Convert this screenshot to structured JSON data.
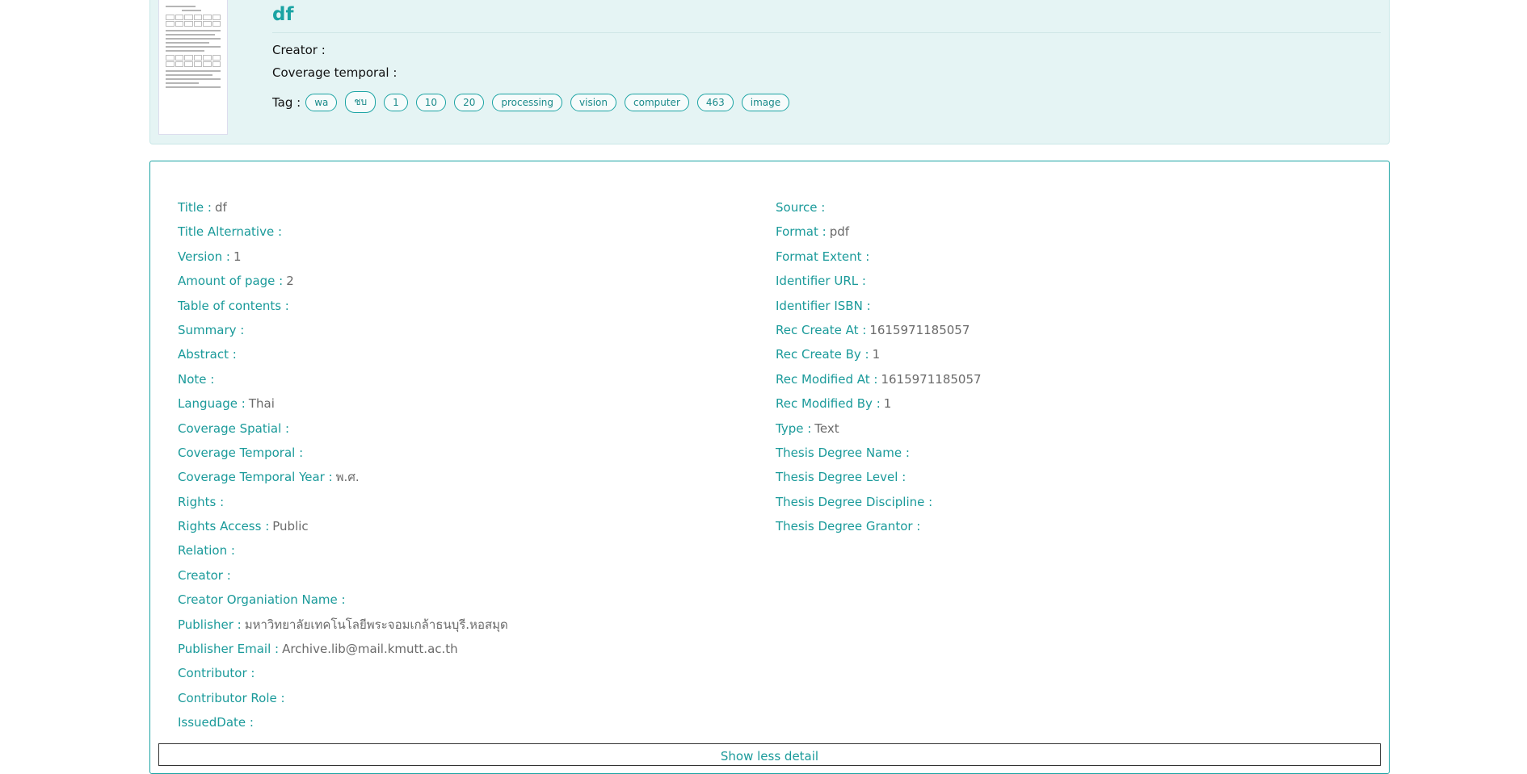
{
  "header": {
    "title": "df",
    "creator_label": "Creator :",
    "coverage_label": "Coverage temporal :",
    "tag_label": "Tag :",
    "tags": [
      "wa",
      "ชบ",
      "1",
      "10",
      "20",
      "processing",
      "vision",
      "computer",
      "463",
      "image"
    ]
  },
  "details": {
    "left": [
      {
        "label": "Title :",
        "value": "df"
      },
      {
        "label": "Title Alternative :",
        "value": ""
      },
      {
        "label": "Version :",
        "value": "1"
      },
      {
        "label": "Amount of page :",
        "value": "2"
      },
      {
        "label": "Table of contents :",
        "value": ""
      },
      {
        "label": "Summary :",
        "value": ""
      },
      {
        "label": "Abstract :",
        "value": ""
      },
      {
        "label": "Note :",
        "value": ""
      },
      {
        "label": "Language :",
        "value": "Thai"
      },
      {
        "label": "Coverage Spatial :",
        "value": ""
      },
      {
        "label": "Coverage Temporal :",
        "value": ""
      },
      {
        "label": "Coverage Temporal Year :",
        "value": "พ.ศ."
      },
      {
        "label": "Rights :",
        "value": ""
      },
      {
        "label": "Rights Access :",
        "value": "Public"
      },
      {
        "label": "Relation :",
        "value": ""
      },
      {
        "label": "Creator :",
        "value": ""
      },
      {
        "label": "Creator Organiation Name :",
        "value": ""
      },
      {
        "label": "Publisher :",
        "value": "มหาวิทยาลัยเทคโนโลยีพระจอมเกล้าธนบุรี.หอสมุด"
      },
      {
        "label": "Publisher Email :",
        "value": "Archive.lib@mail.kmutt.ac.th"
      },
      {
        "label": "Contributor :",
        "value": ""
      },
      {
        "label": "Contributor Role :",
        "value": ""
      },
      {
        "label": "IssuedDate :",
        "value": ""
      }
    ],
    "right": [
      {
        "label": "Source :",
        "value": ""
      },
      {
        "label": "Format :",
        "value": "pdf"
      },
      {
        "label": "Format Extent :",
        "value": ""
      },
      {
        "label": "Identifier URL :",
        "value": ""
      },
      {
        "label": "Identifier ISBN :",
        "value": ""
      },
      {
        "label": "Rec Create At :",
        "value": "1615971185057"
      },
      {
        "label": "Rec Create By :",
        "value": "1"
      },
      {
        "label": "Rec Modified At :",
        "value": "1615971185057"
      },
      {
        "label": "Rec Modified By :",
        "value": "1"
      },
      {
        "label": "Type :",
        "value": "Text"
      },
      {
        "label": "Thesis Degree Name :",
        "value": ""
      },
      {
        "label": "Thesis Degree Level :",
        "value": ""
      },
      {
        "label": "Thesis Degree Discipline :",
        "value": ""
      },
      {
        "label": "Thesis Degree Grantor :",
        "value": ""
      }
    ]
  },
  "show_less_label": "Show less detail",
  "colors": {
    "accent": "#1aa3a3",
    "card_bg": "#e5f4f4"
  }
}
